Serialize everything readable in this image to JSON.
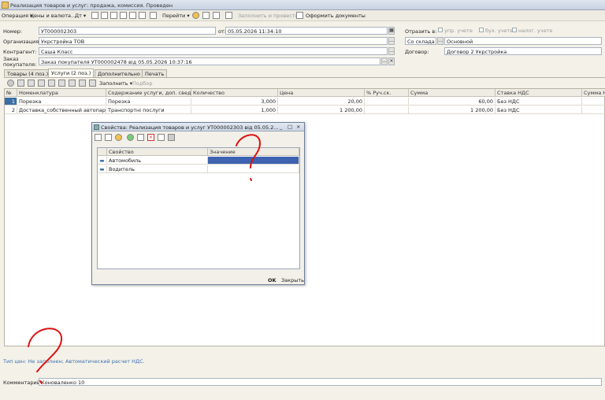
{
  "window": {
    "title": "Реализация товаров и услуг: продажа, комиссия. Проведен"
  },
  "toolbar": {
    "operation": "Операция ▾",
    "prices": "Цены и валюта...",
    "dt": "Дт ▾",
    "goto": "Перейти ▾",
    "post": "Заполнить и провести",
    "print": "Оформить документы"
  },
  "header": {
    "number_label": "Номер:",
    "number": "УТ000002303",
    "date_label": "от:",
    "date": "05.05.2026 11:34:10",
    "org_label": "Организация:",
    "org": "Укрстройка ТОВ",
    "contr_label": "Контрагент:",
    "contr": "Саша Класс",
    "order_label": "Заказ покупателя:",
    "order": "Заказ покупателя УТ000002478 від 05.05.2026 10:37:16",
    "reflect_label": "Отразить в:",
    "cb_upr": "упр. учете",
    "cb_buh": "бух. учете",
    "cb_nal": "налог. учете",
    "warehouse": "Со склада",
    "warehouse_value": "Основной",
    "contract_label": "Договор:",
    "contract": "Договор 2 Укрстройка"
  },
  "tabs": [
    "Товары (4 поз.)",
    "Услуги (2 поз.)",
    "Дополнительно",
    "Печать"
  ],
  "subtoolbar": {
    "fill": "Заполнить ▾",
    "select": "Подбор"
  },
  "grid": {
    "headers": [
      "№",
      "Номенклатура",
      "Содержание услуги, доп. сведения",
      "Количество",
      "Цена",
      "% Руч.ск.",
      "Сумма",
      "Ставка НДС",
      "Сумма НДС"
    ],
    "rows": [
      [
        "1",
        "Порезка",
        "Порезка",
        "3,000",
        "20,00",
        "",
        "60,00",
        "Без НДС",
        ""
      ],
      [
        "2",
        "Доставка_собственный автопарк",
        "Транспортні послуги",
        "1,000",
        "1 200,00",
        "",
        "1 200,00",
        "Без НДС",
        ""
      ]
    ]
  },
  "dialog": {
    "title": "Свойства: Реализация товаров и услуг УТ000002303 від 05.05.2...",
    "col1": "Свойство",
    "col2": "Значение",
    "rows": [
      "Автомобиль",
      "Водитель"
    ],
    "ok": "OK",
    "close": "Закрыть"
  },
  "footer": {
    "price_type": "Тип цен: Не заполнен; Автоматический расчет НДС.",
    "comment_label": "Комментарий:",
    "comment": "Коноваленко 10"
  }
}
